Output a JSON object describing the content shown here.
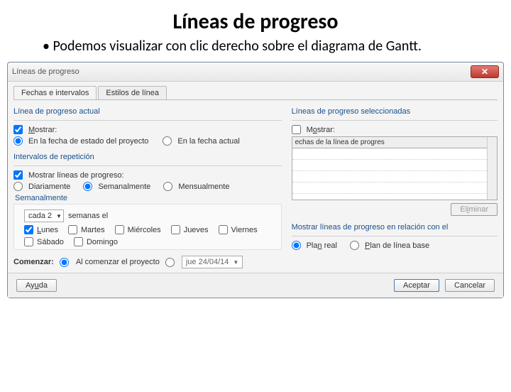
{
  "slide": {
    "title": "Líneas de progreso",
    "bullet": "Podemos visualizar con clic derecho sobre el diagrama de Gantt."
  },
  "dialog": {
    "title": "Líneas de progreso",
    "tabs": {
      "dates": "Fechas e intervalos",
      "styles": "Estilos de línea"
    },
    "left": {
      "group_current": "Línea de progreso actual",
      "show": "Mostrar:",
      "at_status_date": "En la fecha de estado del proyecto",
      "at_current_date": "En la fecha actual",
      "group_repeat": "Intervalos de repetición",
      "show_lines": "Mostrar líneas de progreso:",
      "daily": "Diariamente",
      "weekly": "Semanalmente",
      "monthly": "Mensualmente",
      "sub_weekly": "Semanalmente",
      "every_value": "cada 2",
      "weeks_on": "semanas el",
      "days": {
        "mon": "Lunes",
        "tue": "Martes",
        "wed": "Miércoles",
        "thu": "Jueves",
        "fri": "Viernes",
        "sat": "Sábado",
        "sun": "Domingo"
      },
      "begin": "Comenzar:",
      "begin_project": "Al comenzar el proyecto",
      "begin_date_value": "jue 24/04/14"
    },
    "right": {
      "group_selected": "Líneas de progreso seleccionadas",
      "show": "Mostrar:",
      "list_header": "echas de la línea de progres",
      "delete": "Eliminar",
      "group_relative": "Mostrar líneas de progreso en relación con el",
      "plan_real": "Plan real",
      "plan_base": "Plan de línea base"
    },
    "buttons": {
      "help": "Ayuda",
      "ok": "Aceptar",
      "cancel": "Cancelar"
    }
  }
}
